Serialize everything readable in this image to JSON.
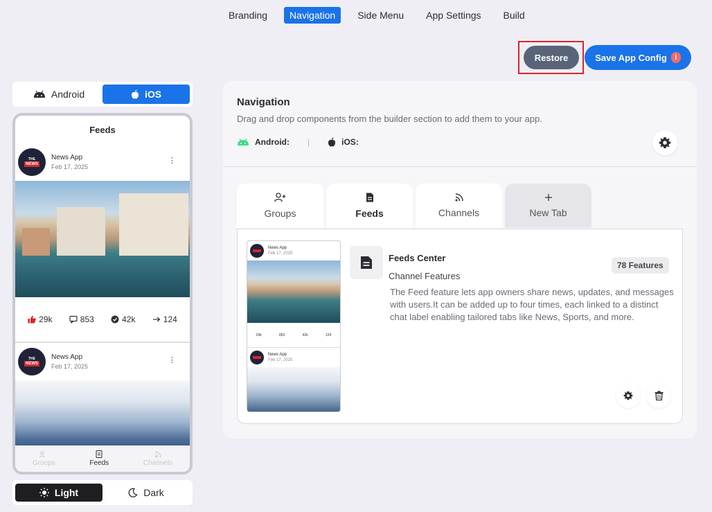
{
  "topnav": {
    "tabs": [
      {
        "label": "Branding"
      },
      {
        "label": "Navigation"
      },
      {
        "label": "Side Menu"
      },
      {
        "label": "App Settings"
      },
      {
        "label": "Build"
      }
    ],
    "active": "Navigation"
  },
  "actions": {
    "restore_label": "Restore",
    "save_label": "Save App Config",
    "save_warning": "!"
  },
  "platform": {
    "android_label": "Android",
    "ios_label": "iOS",
    "active": "iOS"
  },
  "phone": {
    "title": "Feeds",
    "posts": [
      {
        "author": "News App",
        "date": "Feb 17, 2025",
        "likes": "29k",
        "comments": "853",
        "verified": "42k",
        "shares": "124"
      },
      {
        "author": "News App",
        "date": "Feb 17, 2025"
      }
    ],
    "avatar_text_top": "THE",
    "avatar_text_bottom": "NEWS",
    "tabs": [
      {
        "label": "Groups"
      },
      {
        "label": "Feeds"
      },
      {
        "label": "Channels"
      }
    ]
  },
  "theme": {
    "light_label": "Light",
    "dark_label": "Dark",
    "active": "Light"
  },
  "panel": {
    "title": "Navigation",
    "subtitle": "Drag and drop components from the builder section to add them to your app.",
    "android_label": "Android:",
    "ios_label": "iOS:",
    "separator": "|",
    "tabs": [
      {
        "label": "Groups",
        "icon": "user-plus-icon"
      },
      {
        "label": "Feeds",
        "icon": "document-icon"
      },
      {
        "label": "Channels",
        "icon": "rss-icon"
      },
      {
        "label": "New Tab",
        "icon": "plus-icon"
      }
    ],
    "active_tab": "Feeds",
    "feature": {
      "title": "Feeds Center",
      "badge": "78 Features",
      "subtitle": "Channel Features",
      "description": "The Feed feature lets app owners share news, updates, and messages with users.It can be added up to four times, each linked to a distinct chat label enabling tailored tabs like News, Sports, and more."
    },
    "mini_preview": {
      "author": "News App",
      "date": "Feb 17, 2025",
      "likes": "29k",
      "comments": "853",
      "verified": "42k",
      "shares": "124"
    }
  },
  "colors": {
    "accent": "#1a73e8",
    "restore": "#5a6479",
    "highlight_frame": "#d9252a",
    "android_green": "#3ddc84"
  }
}
